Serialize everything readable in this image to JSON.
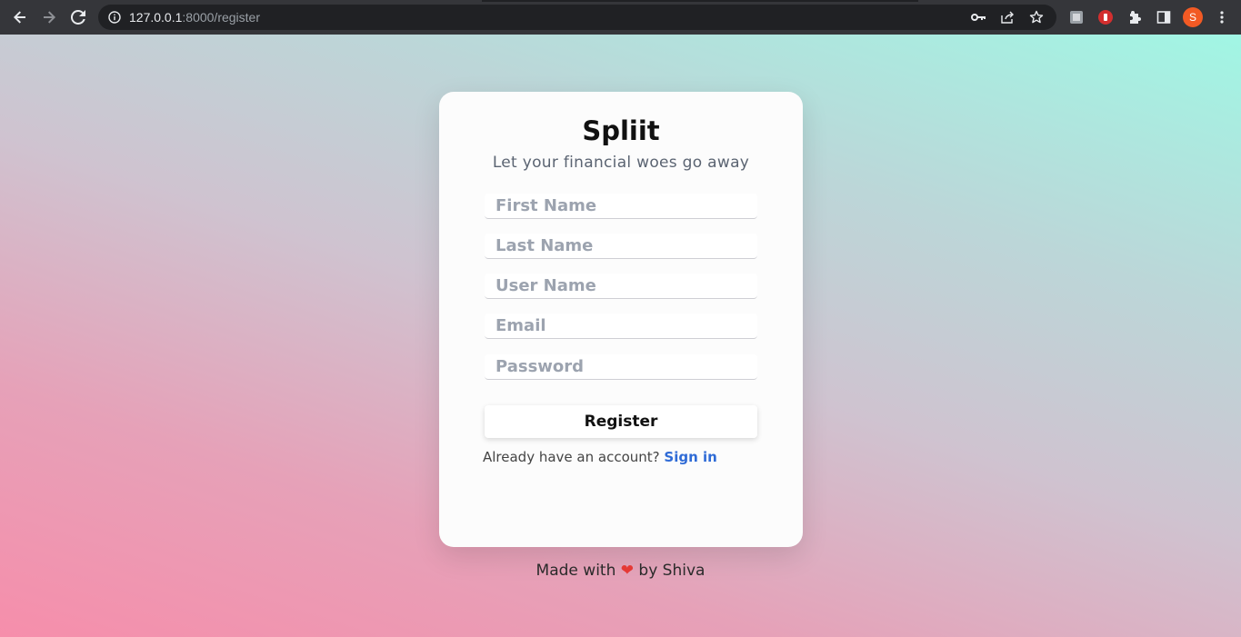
{
  "browser": {
    "url_host": "127.0.0.1",
    "url_rest": ":8000/register",
    "profile_initial": "S"
  },
  "app": {
    "title": "Spliit",
    "tagline": "Let your financial woes go away"
  },
  "form": {
    "first_name_placeholder": "First Name",
    "last_name_placeholder": "Last Name",
    "user_name_placeholder": "User Name",
    "email_placeholder": "Email",
    "password_placeholder": "Password",
    "submit_label": "Register",
    "signin_prompt": "Already have an account?",
    "signin_link": "Sign in"
  },
  "footer": {
    "made_with": "Made with",
    "heart": "❤",
    "by": "by Shiva"
  },
  "colors": {
    "accent_link": "#2f6bd6",
    "heart": "#e53935",
    "avatar": "#f25a24"
  },
  "icons": {
    "nav": [
      "back-arrow-icon",
      "forward-arrow-icon",
      "reload-icon"
    ],
    "omnibox": [
      "info-icon",
      "key-icon",
      "share-icon",
      "star-icon"
    ],
    "toolbar": [
      "extension-icon",
      "stop-extension-icon",
      "puzzle-icon",
      "side-panel-icon",
      "menu-kebab-icon"
    ]
  }
}
